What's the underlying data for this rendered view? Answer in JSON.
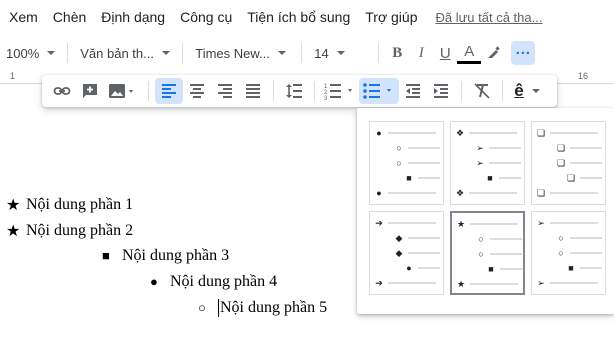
{
  "menu": {
    "items": [
      "Xem",
      "Chèn",
      "Định dạng",
      "Công cụ",
      "Tiện ích bổ sung",
      "Trợ giúp"
    ],
    "saved_status": "Đã lưu tất cả tha..."
  },
  "toolbar": {
    "zoom": "100%",
    "style": "Văn bản th...",
    "font": "Times New...",
    "font_size": "14",
    "bold": "B",
    "italic": "I",
    "underline": "U",
    "text_color": "A",
    "more": "···"
  },
  "ruler": {
    "left_mark": "1",
    "right_mark": "16"
  },
  "overflow_toolbar": {
    "buttons": [
      "link-icon",
      "add-comment-icon",
      "image-icon",
      "align-left-icon",
      "align-center-icon",
      "align-right-icon",
      "justify-icon",
      "line-spacing-icon",
      "numbered-list-icon",
      "bulleted-list-icon",
      "decrease-indent-icon",
      "increase-indent-icon",
      "clear-formatting-icon",
      "input-tools-icon"
    ],
    "active": [
      "align-left-icon",
      "bulleted-list-icon"
    ],
    "input_tools_glyph": "ê"
  },
  "document": {
    "lines": [
      {
        "bullet": "★",
        "text": "Nội dung phần 1"
      },
      {
        "bullet": "★",
        "text": "Nội dung phần 2"
      },
      {
        "bullet": "■",
        "text": "Nội dung phần 3"
      },
      {
        "bullet": "●",
        "text": "Nội dung phần 4"
      },
      {
        "bullet": "○",
        "text": "Nội dung phần 5"
      }
    ]
  },
  "bullet_presets": [
    {
      "name": "disc-circle-square",
      "glyphs": [
        "●",
        "○",
        "○",
        "■",
        "●"
      ],
      "selected": false
    },
    {
      "name": "diamond-arrow-square",
      "glyphs": [
        "❖",
        "➢",
        "➢",
        "■",
        "❖"
      ],
      "selected": false
    },
    {
      "name": "hollow-square",
      "glyphs": [
        "❏",
        "❏",
        "❏",
        "❏",
        "❏"
      ],
      "selected": false
    },
    {
      "name": "arrow-diamond-disc",
      "glyphs": [
        "➔",
        "◆",
        "◆",
        "●",
        "➔"
      ],
      "selected": false
    },
    {
      "name": "star-circle-square",
      "glyphs": [
        "★",
        "○",
        "○",
        "■",
        "★"
      ],
      "selected": true
    },
    {
      "name": "arrowhead-circle-square",
      "glyphs": [
        "➢",
        "○",
        "○",
        "■",
        "➢"
      ],
      "selected": false
    }
  ],
  "colors": {
    "accent": "#1a73e8",
    "active_bg": "#d2e3fc",
    "text_color_underline": "#000000"
  }
}
